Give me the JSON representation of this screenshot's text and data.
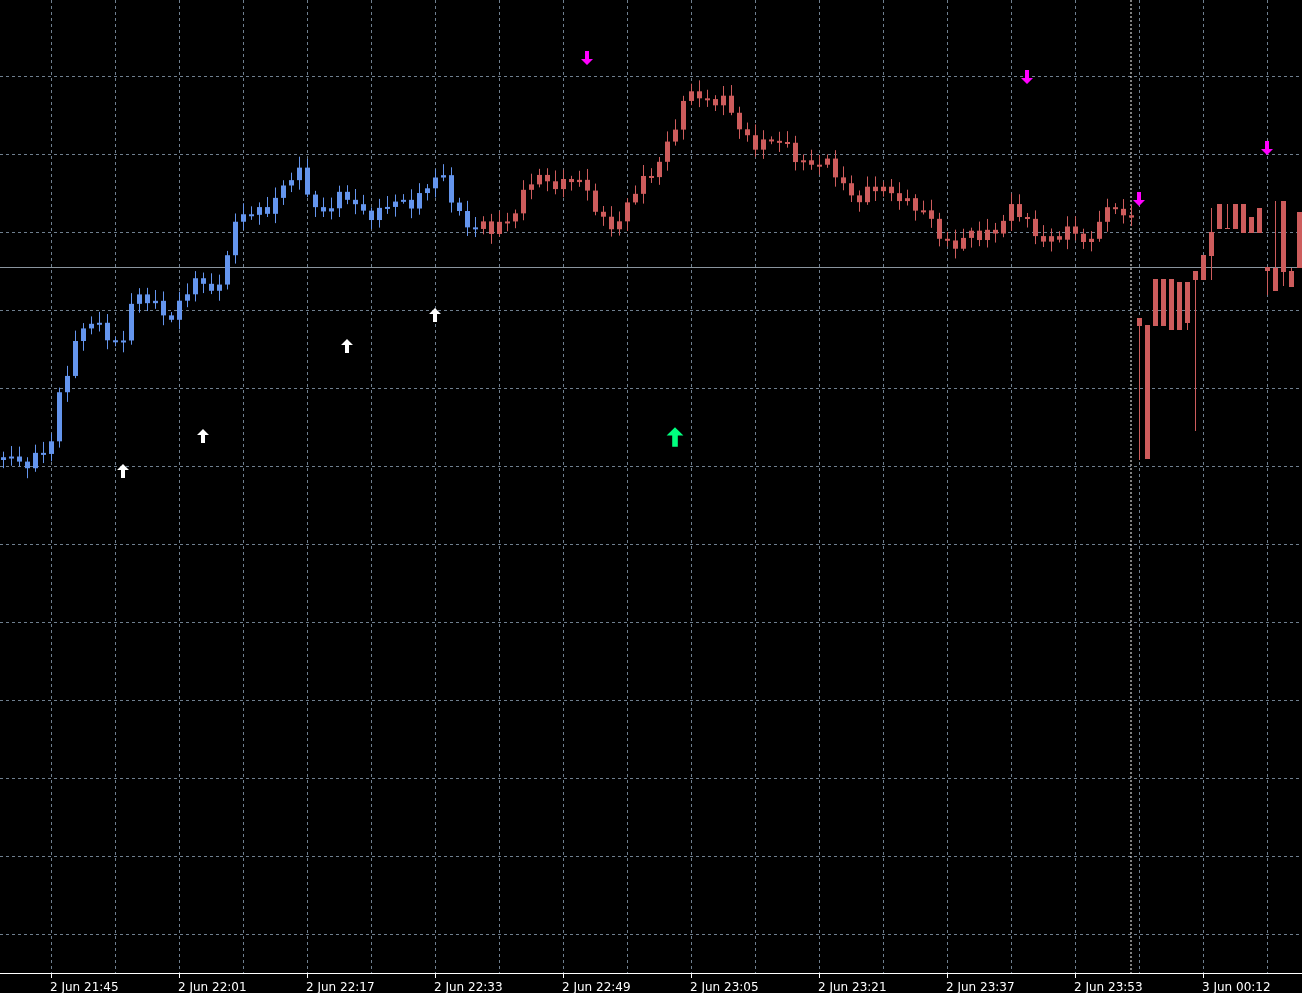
{
  "time_axis": {
    "labels": [
      "2 Jun 21:45",
      "2 Jun 22:01",
      "2 Jun 22:17",
      "2 Jun 22:33",
      "2 Jun 22:49",
      "2 Jun 23:05",
      "2 Jun 23:21",
      "2 Jun 23:37",
      "2 Jun 23:53",
      "3 Jun 00:12"
    ]
  },
  "signals": [
    {
      "kind": "up",
      "color": "#ffffff"
    },
    {
      "kind": "up",
      "color": "#ffffff"
    },
    {
      "kind": "up",
      "color": "#ffffff"
    },
    {
      "kind": "up",
      "color": "#ffffff"
    },
    {
      "kind": "up",
      "color": "#00ff7f"
    },
    {
      "kind": "down",
      "color": "#ff00ff"
    },
    {
      "kind": "down",
      "color": "#ff00ff"
    },
    {
      "kind": "down",
      "color": "#ff00ff"
    },
    {
      "kind": "down",
      "color": "#ff00ff"
    }
  ]
}
